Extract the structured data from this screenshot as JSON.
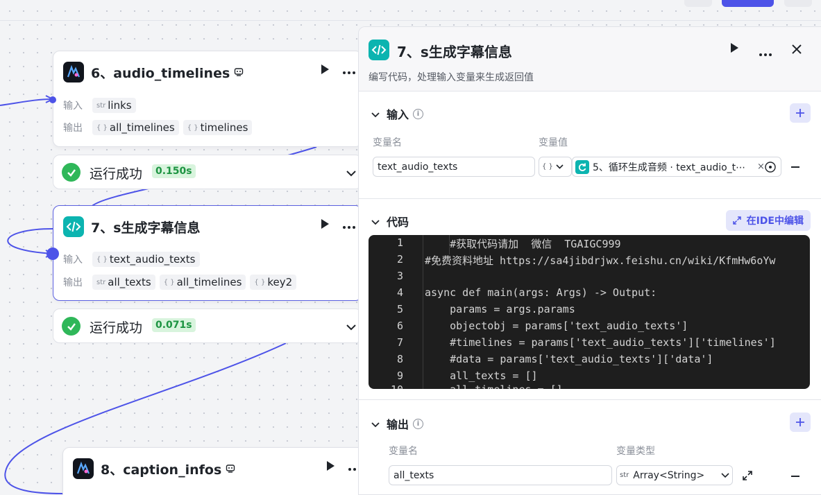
{
  "nodes": {
    "audio_timelines": {
      "title": "6、audio_timelines",
      "input_label": "输入",
      "output_label": "输出",
      "inputs": [
        {
          "type": "str",
          "name": "links"
        }
      ],
      "outputs": [
        {
          "type": "{ }",
          "name": "all_timelines"
        },
        {
          "type": "{ }",
          "name": "timelines"
        }
      ],
      "status": "运行成功",
      "time": "0.150s"
    },
    "subtitle": {
      "title": "7、s生成字幕信息",
      "input_label": "输入",
      "output_label": "输出",
      "inputs": [
        {
          "type": "{ }",
          "name": "text_audio_texts"
        }
      ],
      "outputs": [
        {
          "type": "str",
          "name": "all_texts"
        },
        {
          "type": "{ }",
          "name": "all_timelines"
        },
        {
          "type": "{ }",
          "name": "key2"
        }
      ],
      "status": "运行成功",
      "time": "0.071s"
    },
    "caption_infos": {
      "title": "8、caption_infos"
    }
  },
  "panel": {
    "title": "7、s生成字幕信息",
    "description": "编写代码，处理输入变量来生成返回值",
    "input_section": {
      "title": "输入",
      "col_name": "变量名",
      "col_value": "变量值",
      "var_name": "text_audio_texts",
      "ref_type": "{ }",
      "ref_value": "5、循环生成音频 · text_audio_t⋯"
    },
    "code_section": {
      "title": "代码",
      "ide_button": "在IDE中编辑",
      "lines": [
        "    #获取代码请加  微信  TGAIGC999",
        "#免费资料地址 https://sa4jibdrjwx.feishu.cn/wiki/KfmHw6oYw",
        "",
        "async def main(args: Args) -> Output:",
        "    params = args.params",
        "    objectobj = params['text_audio_texts']",
        "    #timelines = params['text_audio_texts']['timelines']",
        "    #data = params['text_audio_texts']['data']",
        "    all_texts = []",
        "    all_timelines = []"
      ]
    },
    "output_section": {
      "title": "输出",
      "col_name": "变量名",
      "col_type": "变量类型",
      "var_name": "all_texts",
      "var_type_tag": "str",
      "var_type": "Array<String>"
    }
  }
}
